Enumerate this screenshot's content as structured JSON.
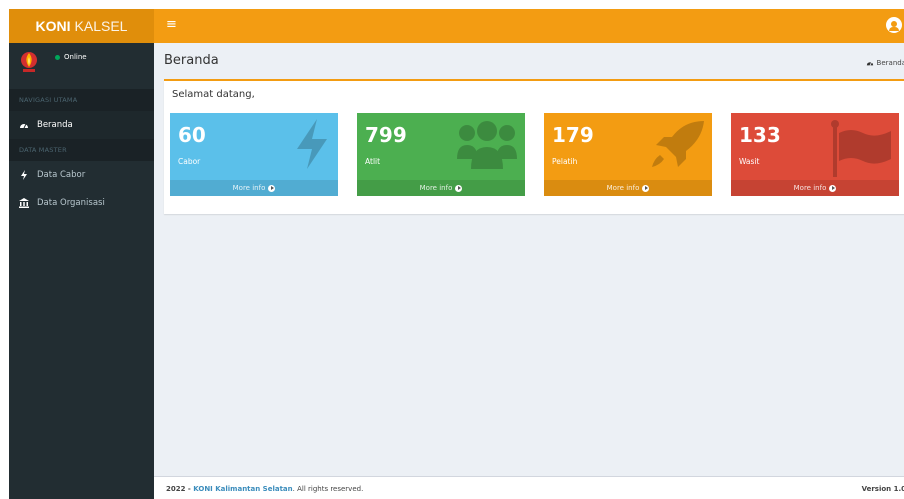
{
  "header": {
    "logo_bold": "KONI",
    "logo_light": "KALSEL",
    "menu_toggle": "≡"
  },
  "sidebar": {
    "status": "Online",
    "sections": [
      {
        "title": "NAVIGASI UTAMA"
      },
      {
        "title": "DATA MASTER"
      }
    ],
    "items": [
      {
        "label": "Beranda",
        "icon": "dashboard-icon"
      },
      {
        "label": "Data Cabor",
        "icon": "bolt-icon"
      },
      {
        "label": "Data Organisasi",
        "icon": "institution-icon"
      }
    ]
  },
  "content": {
    "title": "Beranda",
    "breadcrumb": "Beranda",
    "welcome": "Selamat datang,"
  },
  "tiles": [
    {
      "value": "60",
      "label": "Cabor",
      "more": "More info",
      "color": "#5bc0ea",
      "icon": "bolt-icon"
    },
    {
      "value": "799",
      "label": "Atlit",
      "more": "More info",
      "color": "#4caf50",
      "icon": "users-icon"
    },
    {
      "value": "179",
      "label": "Pelatih",
      "more": "More info",
      "color": "#f39c12",
      "icon": "rocket-icon"
    },
    {
      "value": "133",
      "label": "Wasit",
      "more": "More info",
      "color": "#dd4b39",
      "icon": "flag-icon"
    }
  ],
  "footer": {
    "year": "2022 - ",
    "org": "KONI Kalimantan Selatan",
    "rights": ". All rights reserved.",
    "version": "Version 1.0"
  }
}
